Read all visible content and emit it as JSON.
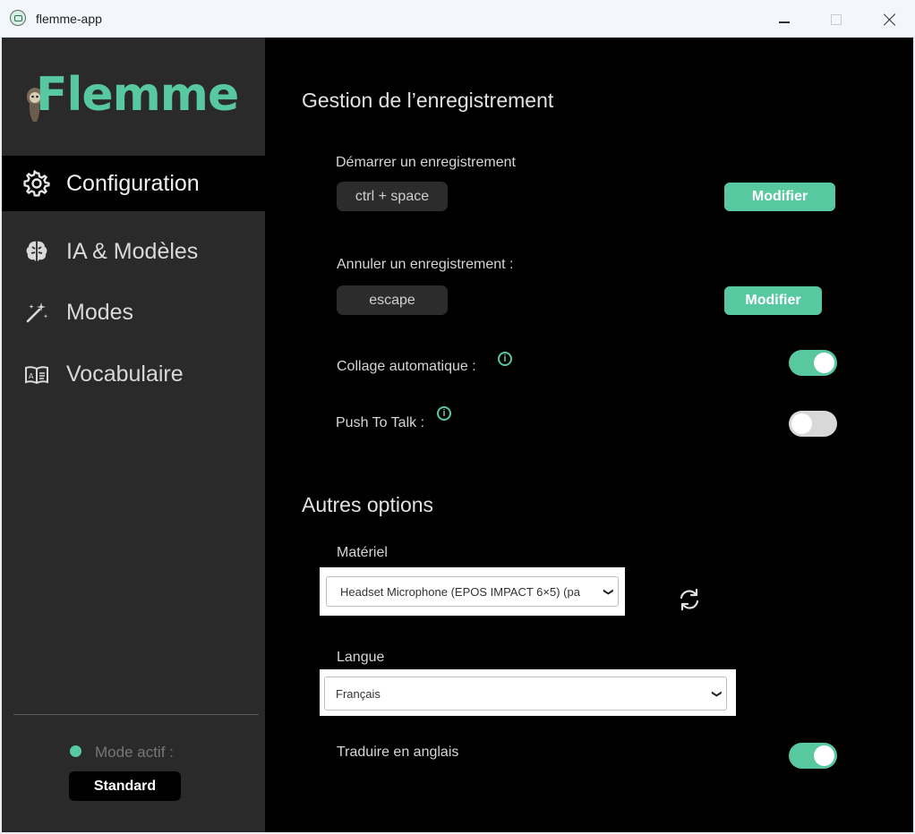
{
  "window": {
    "title": "flemme-app"
  },
  "sidebar": {
    "logo_text": "Flemme",
    "nav": [
      {
        "label": "Configuration",
        "icon": "gear-icon",
        "active": true
      },
      {
        "label": "IA & Modèles",
        "icon": "brain-icon",
        "active": false
      },
      {
        "label": "Modes",
        "icon": "magic-wand-icon",
        "active": false
      },
      {
        "label": "Vocabulaire",
        "icon": "book-icon",
        "active": false
      }
    ],
    "mode_label": "Mode actif :",
    "mode_value": "Standard"
  },
  "main": {
    "section1_title": "Gestion de l’enregistrement",
    "start_label": "Démarrer un enregistrement",
    "start_key": "ctrl + space",
    "cancel_label": "Annuler un enregistrement :",
    "cancel_key": "escape",
    "modify_label": "Modifier",
    "autopaste_label": "Collage automatique :",
    "autopaste_on": true,
    "ptt_label": "Push To Talk :",
    "ptt_on": false,
    "info_glyph": "i",
    "section2_title": "Autres options",
    "device_label": "Matériel",
    "device_value": "Headset Microphone (EPOS IMPACT 6×5) (pa",
    "language_label": "Langue",
    "language_value": "Français",
    "translate_label": "Traduire en anglais",
    "translate_on": true
  },
  "colors": {
    "accent": "#58c8a0",
    "sidebar_bg": "#2a2a2a",
    "main_bg": "#000000"
  }
}
